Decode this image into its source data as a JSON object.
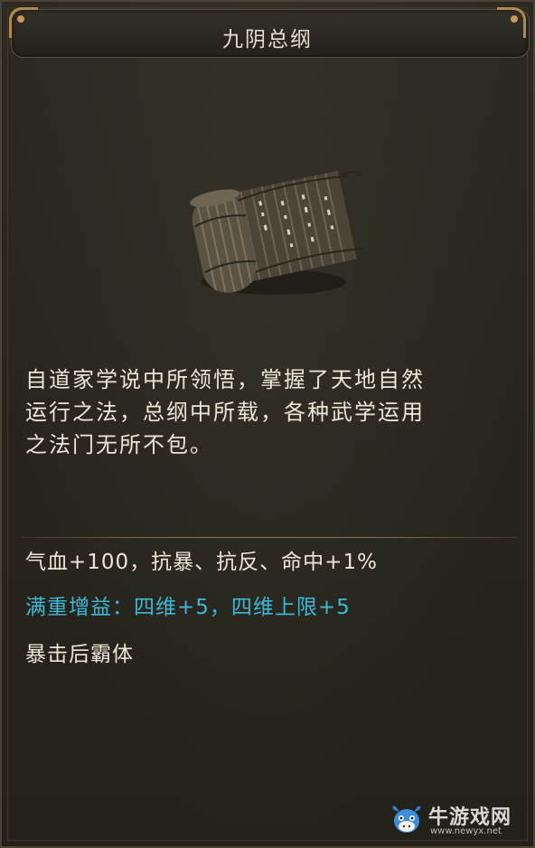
{
  "item": {
    "name": "九阴总纲",
    "icon": "bamboo-scroll-icon",
    "description_lines": [
      "自道家学说中所领悟，掌握了天地自然",
      "运行之法，总纲中所载，各种武学运用",
      "之法门无所不包。"
    ],
    "stats": {
      "base": "气血+100，抗暴、抗反、命中+1%",
      "full_weight_bonus": "满重增益：四维+5，四维上限+5",
      "special": "暴击后霸体"
    }
  },
  "watermark": {
    "brand": "牛游戏网",
    "url": "www.newyx.net"
  },
  "colors": {
    "text": "#ece6d6",
    "bonus": "#3ab9d6",
    "frame_gold": "#b08a4a",
    "background": "#27251e"
  }
}
